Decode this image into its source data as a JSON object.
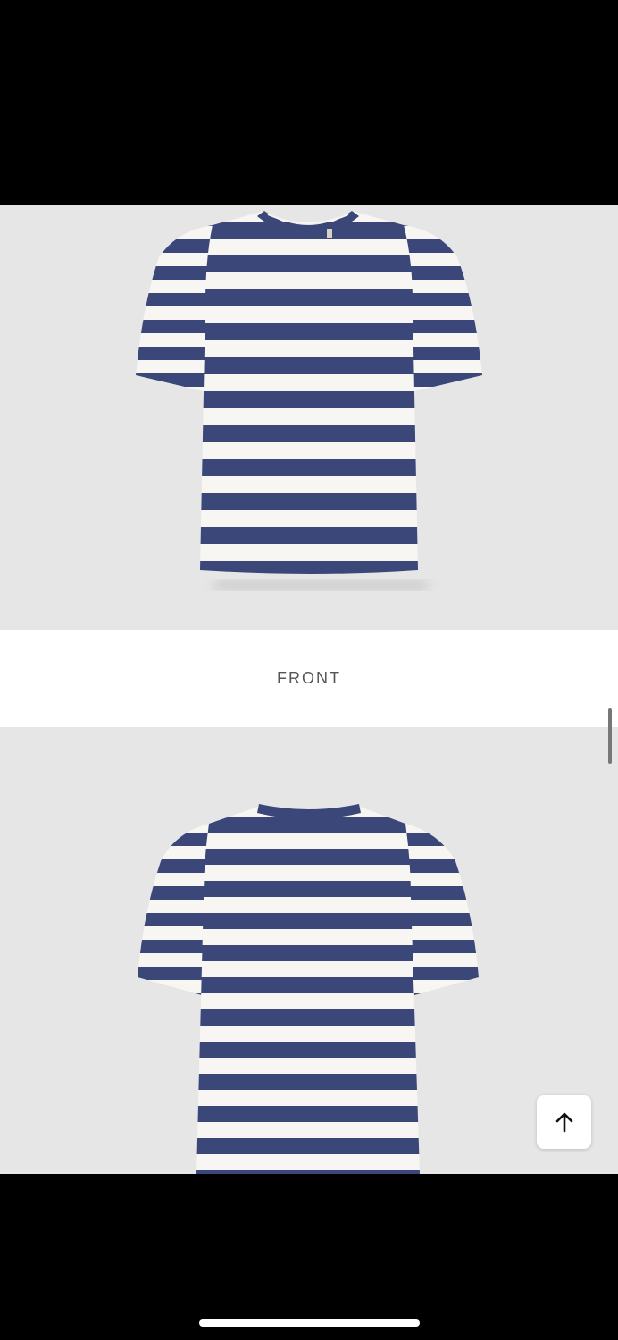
{
  "product_views": {
    "front_caption": "FRONT"
  },
  "colors": {
    "stripe_navy": "#3b4679",
    "stripe_white": "#f7f6f2",
    "photo_background": "#e6e6e6"
  },
  "controls": {
    "scroll_to_top_icon": "arrow-up-icon"
  }
}
